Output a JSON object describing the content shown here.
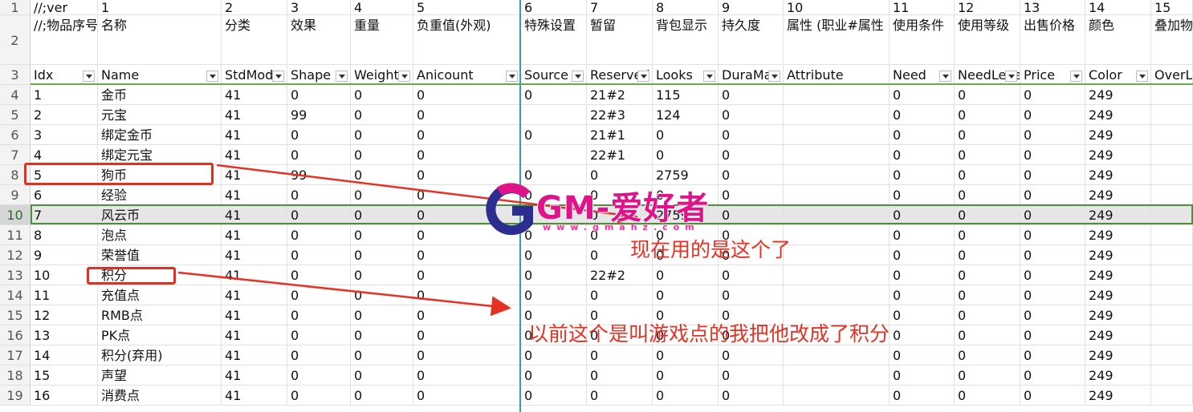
{
  "row_numbers": [
    "1",
    "2",
    "3",
    "4",
    "5",
    "6",
    "7",
    "8",
    "9",
    "10",
    "11",
    "12",
    "13",
    "14",
    "15",
    "16",
    "17",
    "18",
    "19"
  ],
  "header_rows": {
    "ver": [
      "//;ver",
      "1",
      "2",
      "3",
      "4",
      "5",
      "6",
      "7",
      "8",
      "9",
      "10",
      "11",
      "12",
      "13",
      "14",
      "15"
    ],
    "zh": [
      "//;物品序号",
      "名称",
      "分类",
      "效果",
      "重量",
      "负重值(外观)",
      "特殊设置",
      "暂留",
      "背包显示",
      "持久度",
      "属性 (职业#属性",
      "使用条件",
      "使用等级",
      "出售价格",
      "颜色",
      "叠加物"
    ],
    "en": [
      "Idx",
      "Name",
      "StdMode",
      "Shape",
      "Weight",
      "Anicount",
      "Source",
      "Reserved",
      "Looks",
      "DuraMax",
      "Attribute",
      "Need",
      "NeedLevel",
      "Price",
      "Color",
      "OverLap"
    ]
  },
  "data_rows": [
    [
      "1",
      "金币",
      "41",
      "0",
      "0",
      "0",
      "0",
      "21#2",
      "115",
      "0",
      "",
      "0",
      "0",
      "0",
      "249",
      ""
    ],
    [
      "2",
      "元宝",
      "41",
      "99",
      "0",
      "0",
      "",
      "22#3",
      "124",
      "0",
      "",
      "0",
      "0",
      "0",
      "249",
      ""
    ],
    [
      "3",
      "绑定金币",
      "41",
      "0",
      "0",
      "0",
      "0",
      "21#1",
      "0",
      "0",
      "",
      "0",
      "0",
      "0",
      "249",
      ""
    ],
    [
      "4",
      "绑定元宝",
      "41",
      "0",
      "0",
      "0",
      "",
      "22#1",
      "0",
      "0",
      "",
      "0",
      "0",
      "0",
      "249",
      ""
    ],
    [
      "5",
      "狗币",
      "41",
      "99",
      "0",
      "0",
      "0",
      "0",
      "2759",
      "0",
      "",
      "0",
      "0",
      "0",
      "249",
      ""
    ],
    [
      "6",
      "经验",
      "41",
      "0",
      "0",
      "0",
      "0",
      "0",
      "0",
      "0",
      "",
      "0",
      "0",
      "0",
      "249",
      ""
    ],
    [
      "7",
      "风云币",
      "41",
      "0",
      "0",
      "0",
      "0",
      "0",
      "2759",
      "0",
      "",
      "0",
      "0",
      "0",
      "249",
      ""
    ],
    [
      "8",
      "泡点",
      "41",
      "0",
      "0",
      "0",
      "0",
      "0",
      "0",
      "0",
      "",
      "0",
      "0",
      "0",
      "249",
      ""
    ],
    [
      "9",
      "荣誉值",
      "41",
      "0",
      "0",
      "0",
      "0",
      "0",
      "0",
      "0",
      "",
      "0",
      "0",
      "0",
      "249",
      ""
    ],
    [
      "10",
      "积分",
      "41",
      "0",
      "0",
      "0",
      "0",
      "22#2",
      "0",
      "0",
      "",
      "0",
      "0",
      "0",
      "249",
      ""
    ],
    [
      "11",
      "充值点",
      "41",
      "0",
      "0",
      "0",
      "0",
      "0",
      "0",
      "0",
      "",
      "0",
      "0",
      "0",
      "249",
      ""
    ],
    [
      "12",
      "RMB点",
      "41",
      "0",
      "0",
      "0",
      "0",
      "0",
      "0",
      "0",
      "",
      "0",
      "0",
      "0",
      "249",
      ""
    ],
    [
      "13",
      "PK点",
      "41",
      "0",
      "0",
      "0",
      "0",
      "0",
      "0",
      "0",
      "",
      "0",
      "0",
      "0",
      "249",
      ""
    ],
    [
      "14",
      "积分(弃用)",
      "41",
      "0",
      "0",
      "0",
      "0",
      "0",
      "0",
      "0",
      "",
      "0",
      "0",
      "0",
      "249",
      ""
    ],
    [
      "15",
      "声望",
      "41",
      "0",
      "0",
      "0",
      "0",
      "0",
      "0",
      "0",
      "",
      "0",
      "0",
      "0",
      "249",
      ""
    ],
    [
      "16",
      "消费点",
      "41",
      "0",
      "0",
      "0",
      "0",
      "0",
      "0",
      "0",
      "",
      "0",
      "0",
      "0",
      "249",
      ""
    ]
  ],
  "selected_row_number": "10",
  "annotations": {
    "note_current": "现在用的是这个了",
    "note_renamed": "以前这个是叫游戏点的我把他改成了积分",
    "note_color": "#e63224"
  },
  "watermark": {
    "brand": "GM-爱好者",
    "url": "www.gmahz.com",
    "icon": "gm-logo-icon"
  },
  "colors": {
    "grid": "#e1e1e1",
    "freeze_line": "#2aa7a1",
    "selection": "#4b8f3a",
    "annotation": "#e63224",
    "brand_pink": "#e0148a",
    "brand_blue": "#2b2d8f"
  }
}
